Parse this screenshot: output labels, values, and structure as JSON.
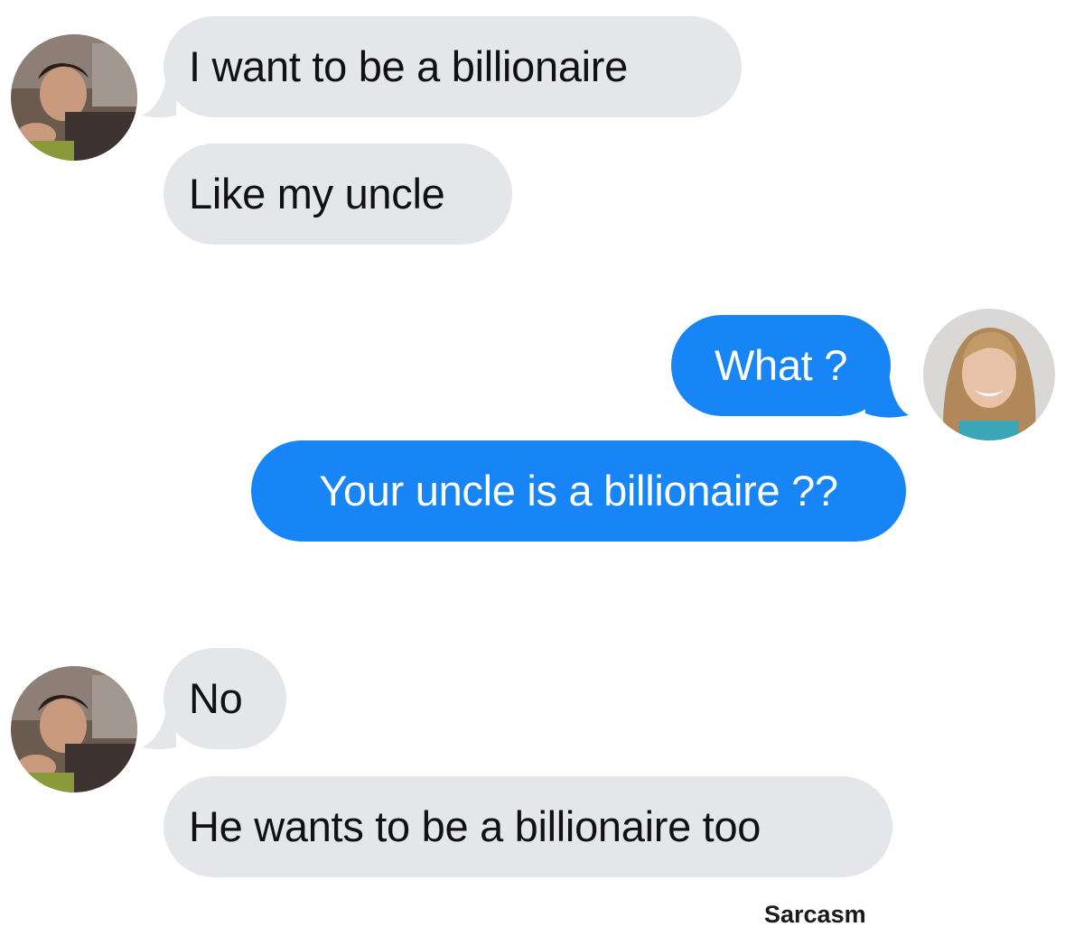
{
  "conversation": {
    "messages": [
      {
        "sender": "other",
        "text": "I want to be a billionaire"
      },
      {
        "sender": "other",
        "text": "Like my uncle"
      },
      {
        "sender": "me",
        "text": "What ?"
      },
      {
        "sender": "me",
        "text": "Your uncle is a billionaire ??"
      },
      {
        "sender": "other",
        "text": "No"
      },
      {
        "sender": "other",
        "text": "He wants to be a billionaire too"
      }
    ],
    "avatars": {
      "other": "man-avatar",
      "me": "woman-avatar"
    }
  },
  "colors": {
    "incoming_bubble": "#e5e6ea",
    "outgoing_bubble": "#1785f5",
    "outgoing_text": "#ffffff",
    "background": "#ffffff"
  },
  "watermark": "Sarcasm"
}
